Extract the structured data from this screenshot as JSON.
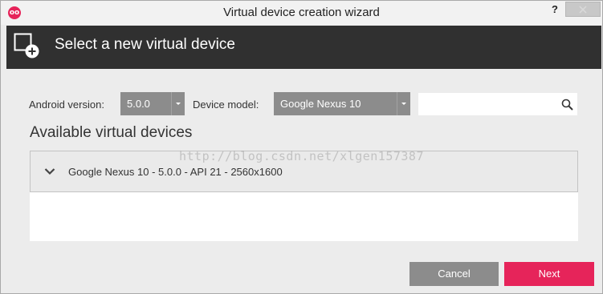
{
  "window": {
    "title": "Virtual device creation wizard",
    "help_label": "?",
    "app_icon_text": "oo"
  },
  "header": {
    "title": "Select a new virtual device",
    "icon": "add-device-icon"
  },
  "form": {
    "android_version_label": "Android version:",
    "android_version_value": "5.0.0",
    "device_model_label": "Device model:",
    "device_model_value": "Google Nexus 10",
    "search_value": "",
    "search_icon": "search-icon"
  },
  "devices": {
    "section_title": "Available virtual devices",
    "items": [
      {
        "label": "Google Nexus 10 - 5.0.0 - API 21 - 2560x1600",
        "expanded": true
      }
    ]
  },
  "watermark": "http://blog.csdn.net/xlgen157387",
  "buttons": {
    "cancel": "Cancel",
    "next": "Next"
  },
  "colors": {
    "accent": "#e6245a",
    "header_bg": "#303030",
    "select_bg": "#8c8c8c"
  }
}
